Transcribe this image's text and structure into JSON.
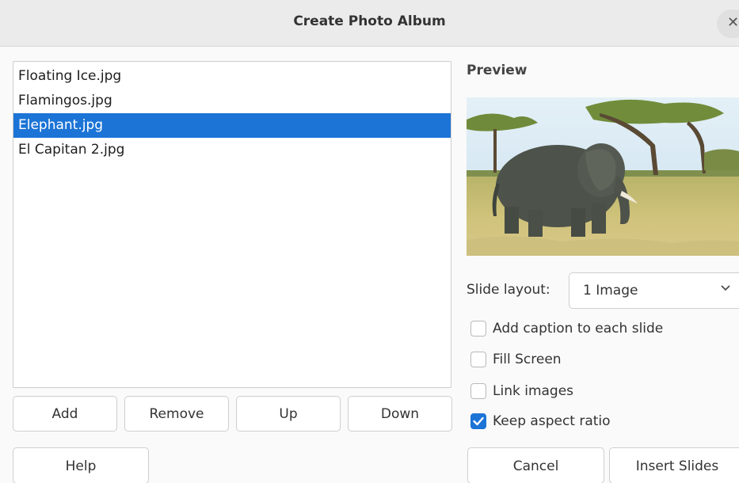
{
  "dialog": {
    "title": "Create Photo Album"
  },
  "files": [
    {
      "name": "Floating Ice.jpg",
      "selected": false
    },
    {
      "name": "Flamingos.jpg",
      "selected": false
    },
    {
      "name": "Elephant.jpg",
      "selected": true
    },
    {
      "name": "El Capitan 2.jpg",
      "selected": false
    }
  ],
  "list_buttons": {
    "add": "Add",
    "remove": "Remove",
    "up": "Up",
    "down": "Down"
  },
  "preview": {
    "heading": "Preview"
  },
  "slide_layout": {
    "label": "Slide layout:",
    "value": "1 Image"
  },
  "options": {
    "add_caption": {
      "label": "Add caption to each slide",
      "checked": false
    },
    "fill_screen": {
      "label": "Fill Screen",
      "checked": false
    },
    "link_images": {
      "label": "Link images",
      "checked": false
    },
    "keep_aspect": {
      "label": "Keep aspect ratio",
      "checked": true
    }
  },
  "footer": {
    "help": "Help",
    "cancel": "Cancel",
    "insert": "Insert Slides"
  },
  "colors": {
    "selection": "#1c74d6",
    "titlebar": "#ebebeb"
  }
}
